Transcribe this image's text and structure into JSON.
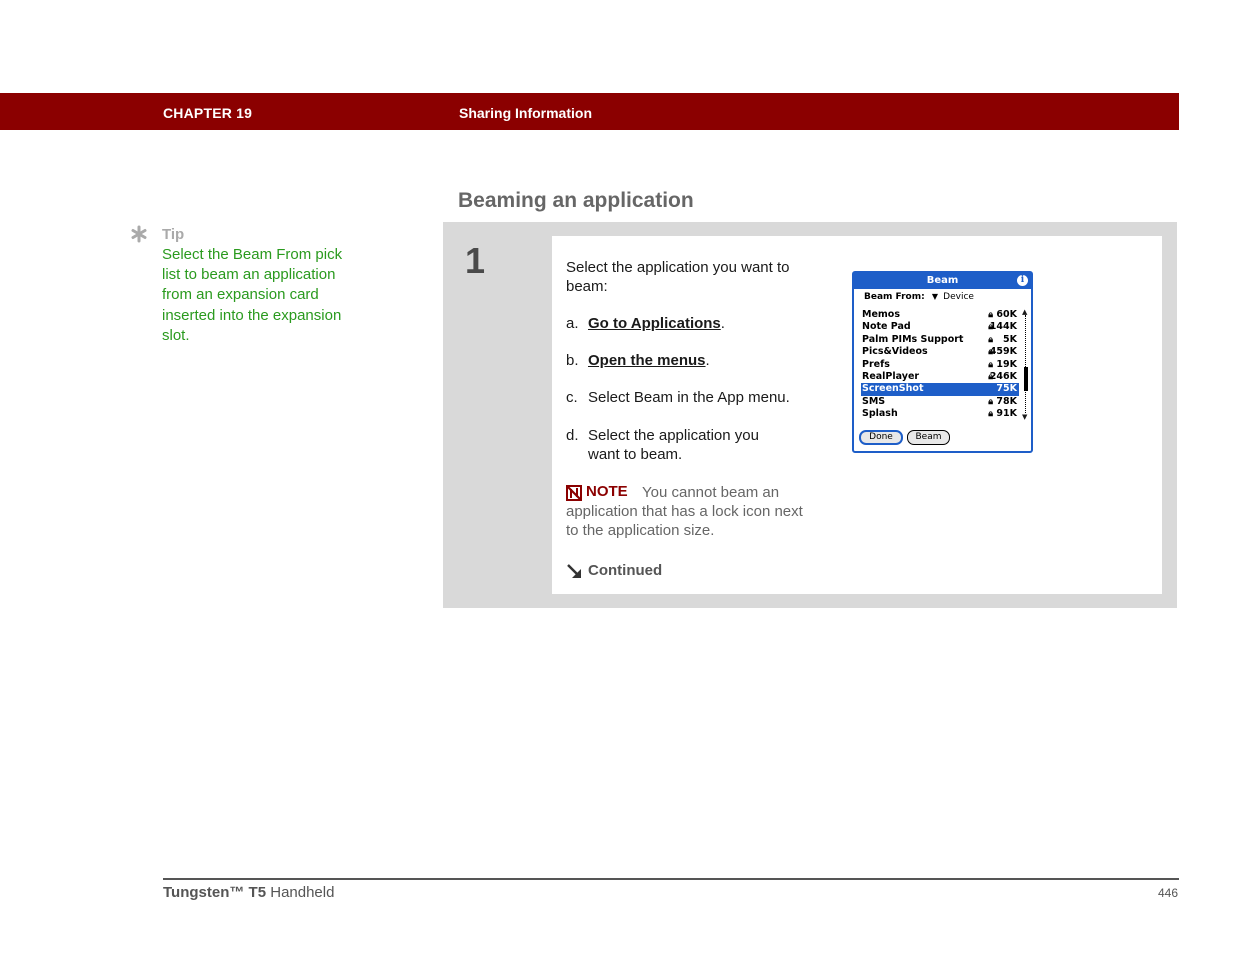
{
  "header": {
    "chapter": "CHAPTER 19",
    "title": "Sharing Information"
  },
  "section": {
    "heading": "Beaming an application"
  },
  "tip": {
    "label": "Tip",
    "text": "Select the Beam From pick list to beam an application from an expansion card inserted into the expansion slot."
  },
  "step": {
    "number": "1",
    "intro": "Select the application you want to beam:",
    "items": [
      {
        "letter": "a.",
        "link": "Go to Applications",
        "after": "."
      },
      {
        "letter": "b.",
        "link": "Open the menus",
        "after": "."
      },
      {
        "letter": "c.",
        "text": "Select Beam in the App menu."
      },
      {
        "letter": "d.",
        "text_line1": "Select the application you",
        "text_line2": "want to beam."
      }
    ],
    "note_label": "NOTE",
    "note_text": "You cannot beam an application that has a lock icon next to the application size.",
    "continued": "Continued"
  },
  "palm": {
    "title": "Beam",
    "info": "i",
    "beam_from_label": "Beam From:",
    "beam_from_value": "Device",
    "apps": [
      {
        "name": "Memos",
        "size": "60K",
        "locked": true
      },
      {
        "name": "Note Pad",
        "size": "144K",
        "locked": true
      },
      {
        "name": "Palm PIMs Support",
        "size": "5K",
        "locked": true
      },
      {
        "name": "Pics&Videos",
        "size": "459K",
        "locked": true
      },
      {
        "name": "Prefs",
        "size": "19K",
        "locked": true
      },
      {
        "name": "RealPlayer",
        "size": "246K",
        "locked": true
      },
      {
        "name": "ScreenShot",
        "size": "75K",
        "locked": false,
        "selected": true
      },
      {
        "name": "SMS",
        "size": "78K",
        "locked": true
      },
      {
        "name": "Splash",
        "size": "91K",
        "locked": true
      }
    ],
    "done_button": "Done",
    "beam_button": "Beam",
    "colors": {
      "accent": "#1e5ec8"
    }
  },
  "footer": {
    "brand_bold": "Tungsten™ T5",
    "brand_rest": " Handheld",
    "page": "446"
  },
  "colors": {
    "chapter_bar": "#8b0000",
    "tip_text": "#2a9a1e",
    "note_label": "#8b0000"
  }
}
